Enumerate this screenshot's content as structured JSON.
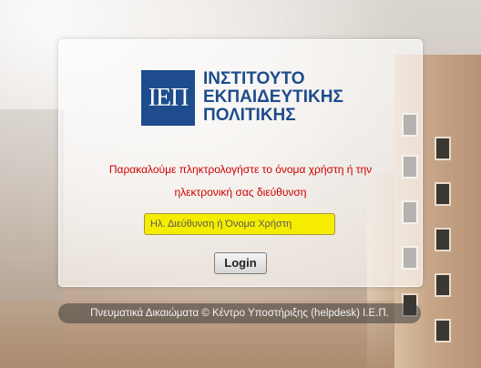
{
  "logo": {
    "mark": "ΙΕΠ",
    "lines": [
      "ΙΝΣΤΙΤΟΥΤΟ",
      "ΕΚΠΑΙΔΕΥΤΙΚΗΣ",
      "ΠΟΛΙΤΙΚΗΣ"
    ]
  },
  "message": {
    "line1": "Παρακαλούμε πληκτρολογήστε το όνομα χρήστη ή την",
    "line2": "ηλεκτρονική σας διεύθυνση"
  },
  "login_field": {
    "placeholder": "Ηλ. Διεύθυνση ή Όνομα Χρήστη",
    "value": ""
  },
  "login_button": {
    "label": "Login"
  },
  "footer": {
    "text": "Πνευματικά Δικαιώματα © Κέντρο Υποστήριξης (helpdesk) Ι.Ε.Π."
  },
  "colors": {
    "brand": "#1e4c8c",
    "message": "#cc0000",
    "field_highlight": "#f5ec00"
  }
}
